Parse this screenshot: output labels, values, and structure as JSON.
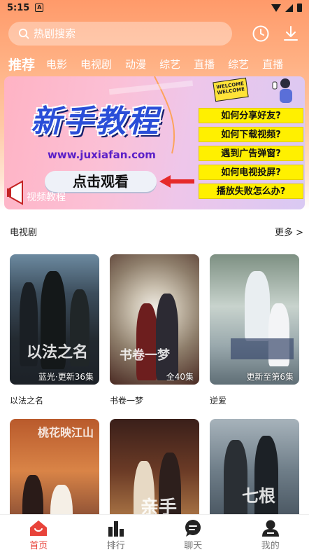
{
  "status_bar": {
    "time": "5:15",
    "notification_glyph": "A"
  },
  "search": {
    "placeholder": "热剧搜索"
  },
  "tabs": [
    {
      "label": "推荐",
      "active": true
    },
    {
      "label": "电影"
    },
    {
      "label": "电视剧"
    },
    {
      "label": "动漫"
    },
    {
      "label": "综艺"
    },
    {
      "label": "直播"
    },
    {
      "label": "综艺"
    },
    {
      "label": "直播"
    }
  ],
  "banner": {
    "title": "新手教程",
    "url": "www.juxiafan.com",
    "cta_label": "点击观看",
    "tag": "视频教程",
    "welcome_text": [
      "WELCOME",
      "WELCOME"
    ],
    "faq": [
      "如何分享好友?",
      "如何下载视频?",
      "遇到广告弹窗?",
      "如何电视投屏?",
      "播放失败怎么办?"
    ]
  },
  "section": {
    "title": "电视剧",
    "more_label": "更多 >"
  },
  "cards": [
    {
      "title": "以法之名",
      "badge": "蓝光·更新36集",
      "deco": "以法之名"
    },
    {
      "title": "书卷一梦",
      "badge": "全40集",
      "deco": "书卷一梦"
    },
    {
      "title": "逆爱",
      "badge": "更新至第6集",
      "deco": ""
    },
    {
      "title": "",
      "badge": "",
      "deco": "桃花映江山"
    },
    {
      "title": "",
      "badge": "",
      "deco": "亲手"
    },
    {
      "title": "",
      "badge": "",
      "deco": "七根"
    }
  ],
  "bottom_nav": [
    {
      "label": "首页",
      "icon": "home-icon",
      "active": true
    },
    {
      "label": "排行",
      "icon": "ranking-icon"
    },
    {
      "label": "聊天",
      "icon": "chat-icon"
    },
    {
      "label": "我的",
      "icon": "profile-icon"
    }
  ],
  "colors": {
    "accent": "#e8433a",
    "header_gradient_top": "#ff9a6a",
    "banner_blue": "#2a4ed8",
    "faq_yellow": "#fff000"
  }
}
